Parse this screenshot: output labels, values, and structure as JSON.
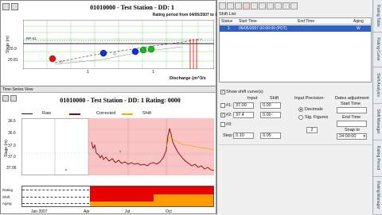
{
  "rating_panel": {
    "title": "01010000 - Test Station - DD: 1",
    "subtitle": "Rating period from 04/05/2007 to 1",
    "ylabel": "Stage (m)",
    "xlabel": "Discharge (m^3/s",
    "ticks_x": [
      "1",
      "1"
    ],
    "ticks_y": [
      "20.9",
      "20.81"
    ],
    "marker_label": "RP-01"
  },
  "timeseries_window": {
    "title": "Time Series View",
    "title_text": "01010000 - Test Station - DD: 1 Rating: 0000",
    "legend": {
      "raw": "Raw",
      "corrected": "Corrected",
      "shift": "Shift"
    },
    "ylabel": "Stage (m)",
    "y_ticks": [
      "36.5",
      "36.6",
      "37.0",
      "37.0",
      "37.06"
    ],
    "bar_labels": [
      "Rating",
      "Shift",
      "Aging"
    ],
    "x_ticks": [
      "Jan 2007",
      "Apr",
      "Jul",
      "Oct"
    ]
  },
  "shift_list": {
    "title": "Shift List",
    "columns": [
      "Status",
      "Start Time",
      "End Time",
      "Aging"
    ],
    "rows": [
      {
        "status": "1",
        "start": "06/05/2007 00:00:00 (PDT)",
        "end": "",
        "aging": "W"
      }
    ]
  },
  "shift_controls": {
    "show_label": "Show shift curve(s)",
    "input_header": "Input",
    "shift_header": "Shift",
    "rows": [
      {
        "label": "#1:",
        "input": "37.00",
        "shift": "0.00",
        "checked": false
      },
      {
        "label": "#2:",
        "input": "37.4",
        "shift": "0.00",
        "checked": true
      },
      {
        "label": "#3:",
        "input": "",
        "shift": "",
        "checked": false
      }
    ],
    "step_label": "Step:",
    "step_input": "0.10",
    "step_shift": "0.05",
    "precision_label": "Input Precision:",
    "precision_opt1": "Decimals",
    "precision_opt2": "Sig. Figures",
    "precision_value": "2",
    "dates_label": "Dates adjustment",
    "start_time_label": "Start Time",
    "end_time_label": "End Time",
    "snap_label": "Snap to",
    "snap_value": "24:00:00"
  },
  "right_tabs": [
    "Rating Table",
    "Rating Curve",
    "Shift Analysis",
    "Shift Manager",
    "Rating Period",
    "Rating Manager"
  ],
  "colors": {
    "raw": "#8b0000",
    "corrected": "#e8b000",
    "shift": "#555555",
    "bg_pink": "#fbc4c4",
    "bar_red": "#e60000",
    "bar_orange": "#ff9900",
    "selection": "#3060c0"
  }
}
